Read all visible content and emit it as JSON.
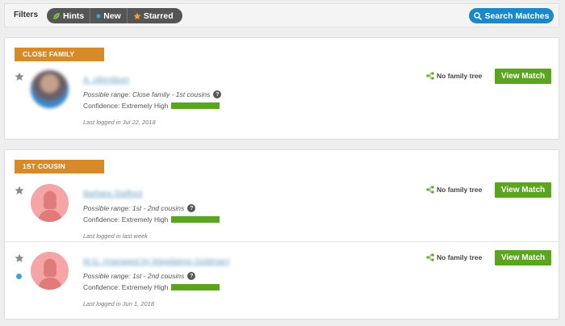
{
  "filters": {
    "label": "Filters",
    "hints": "Hints",
    "new": "New",
    "starred": "Starred"
  },
  "search": {
    "label": "Search Matches"
  },
  "colors": {
    "accent_green": "#5aa41e",
    "header_orange": "#d68a2a",
    "search_blue": "#1a88c9",
    "new_dot": "#3aa6d6"
  },
  "groups": [
    {
      "header": "CLOSE FAMILY",
      "matches": [
        {
          "name": "A. ollienblum",
          "range": "Possible range: Close family - 1st cousins",
          "confidence": "Confidence: Extremely High",
          "confidence_level": 1.0,
          "last_login": "Last logged in Jul 22, 2018",
          "tree_status": "No family tree",
          "action": "View Match",
          "avatar": "photo",
          "is_new": false
        }
      ]
    },
    {
      "header": "1ST COUSIN",
      "matches": [
        {
          "name": "Barbara Stafford",
          "range": "Possible range: 1st - 2nd cousins",
          "confidence": "Confidence: Extremely High",
          "confidence_level": 1.0,
          "last_login": "Last logged in last week",
          "tree_status": "No family tree",
          "action": "View Match",
          "avatar": "silhouette-female",
          "is_new": false
        },
        {
          "name": "M.G. (managed by Magdalene Goldman)",
          "range": "Possible range: 1st - 2nd cousins",
          "confidence": "Confidence: Extremely High",
          "confidence_level": 1.0,
          "last_login": "Last logged in Jun 1, 2018",
          "tree_status": "No family tree",
          "action": "View Match",
          "avatar": "silhouette-female",
          "is_new": true
        }
      ]
    }
  ]
}
